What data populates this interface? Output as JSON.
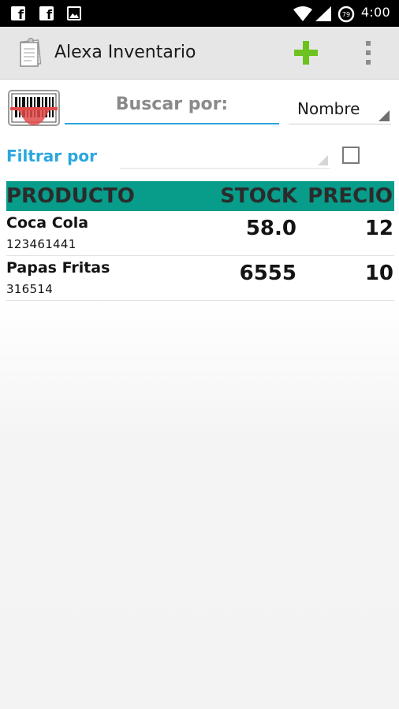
{
  "status_bar": {
    "time": "4:00",
    "icons": [
      "facebook-icon",
      "facebook-icon",
      "image-icon",
      "wifi-icon",
      "signal-icon",
      "data-saver-icon",
      "battery-icon"
    ]
  },
  "app_bar": {
    "title": "Alexa Inventario",
    "icons": [
      "app-logo-icon",
      "add-icon",
      "overflow-menu-icon"
    ]
  },
  "search": {
    "placeholder": "Buscar por:",
    "value": "",
    "sort_by": "Nombre"
  },
  "filter": {
    "label": "Filtrar por",
    "selected": "",
    "checked": false
  },
  "table": {
    "columns": {
      "product": "PRODUCTO",
      "stock": "STOCK",
      "price": "PRECIO"
    },
    "rows": [
      {
        "name": "Coca Cola",
        "code": "123461441",
        "stock": "58.0",
        "price": "12"
      },
      {
        "name": "Papas Fritas",
        "code": "316514",
        "stock": "6555",
        "price": "10"
      }
    ]
  },
  "colors": {
    "accent": "#2ba7de",
    "header_teal": "#089c8a",
    "add_green": "#6cc21f",
    "scanner_red": "#e24a4a"
  }
}
